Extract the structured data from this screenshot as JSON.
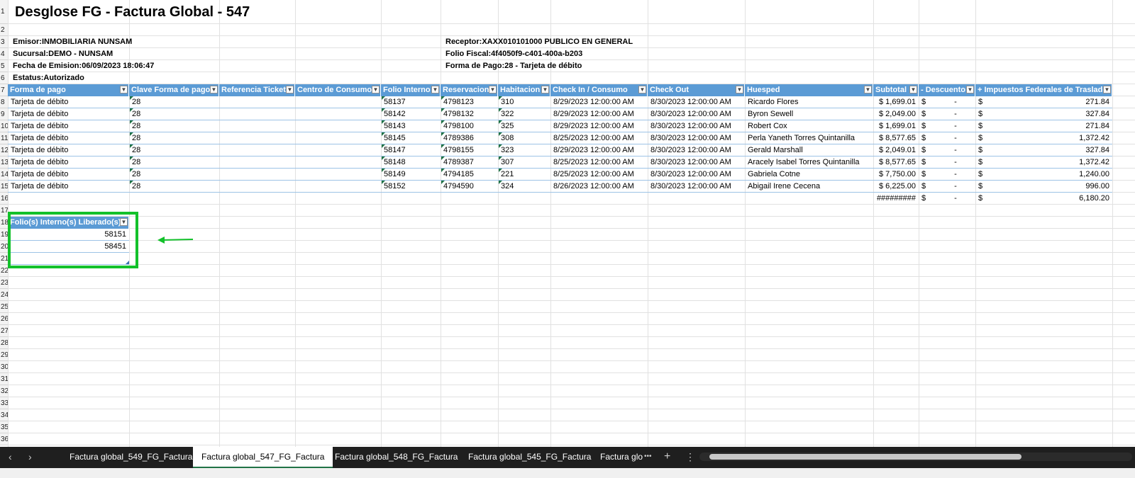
{
  "title": "Desglose FG - Factura Global - 547",
  "info": {
    "emisor": "Emisor:INMOBILIARIA NUNSAM",
    "sucursal": "Sucursal:DEMO - NUNSAM",
    "fecha": "Fecha de Emision:06/09/2023 18:06:47",
    "estatus": "Estatus:Autorizado",
    "receptor": "Receptor:XAXX010101000 PUBLICO EN GENERAL",
    "folio_fiscal": "Folio Fiscal:4f4050f9-c401-400a-b203",
    "forma_pago": "Forma de Pago:28 - Tarjeta de débito"
  },
  "row_numbers": [
    "1",
    "2",
    "3",
    "4",
    "5",
    "6",
    "7",
    "8",
    "9",
    "10",
    "11",
    "12",
    "13",
    "14",
    "15",
    "16",
    "17",
    "18",
    "19",
    "20",
    "21",
    "22",
    "23",
    "24",
    "25",
    "26",
    "27",
    "28",
    "29",
    "30",
    "31",
    "32",
    "33",
    "34",
    "35",
    "36"
  ],
  "table": {
    "headers": [
      "Forma de pago",
      "Clave Forma de pago",
      "Referencia Ticket",
      "Centro de Consumo",
      "Folio Interno",
      "Reservacion",
      "Habitacion",
      "Check In / Consumo",
      "Check Out",
      "Huesped",
      "Subtotal",
      "- Descuento",
      "+ Impuestos Federales de Traslado"
    ],
    "rows": [
      [
        "Tarjeta de débito",
        "28",
        "",
        "",
        "58137",
        "4798123",
        "310",
        "8/29/2023 12:00:00 AM",
        "8/30/2023 12:00:00 AM",
        "Ricardo Flores",
        "$ 1,699.01",
        "$",
        "-",
        "$",
        "271.84"
      ],
      [
        "Tarjeta de débito",
        "28",
        "",
        "",
        "58142",
        "4798132",
        "322",
        "8/29/2023 12:00:00 AM",
        "8/30/2023 12:00:00 AM",
        "Byron Sewell",
        "$ 2,049.00",
        "$",
        "-",
        "$",
        "327.84"
      ],
      [
        "Tarjeta de débito",
        "28",
        "",
        "",
        "58143",
        "4798100",
        "325",
        "8/29/2023 12:00:00 AM",
        "8/30/2023 12:00:00 AM",
        "Robert Cox",
        "$ 1,699.01",
        "$",
        "-",
        "$",
        "271.84"
      ],
      [
        "Tarjeta de débito",
        "28",
        "",
        "",
        "58145",
        "4789386",
        "308",
        "8/25/2023 12:00:00 AM",
        "8/30/2023 12:00:00 AM",
        "Perla Yaneth Torres Quintanilla",
        "$ 8,577.65",
        "$",
        "-",
        "$",
        "1,372.42"
      ],
      [
        "Tarjeta de débito",
        "28",
        "",
        "",
        "58147",
        "4798155",
        "323",
        "8/29/2023 12:00:00 AM",
        "8/30/2023 12:00:00 AM",
        "Gerald Marshall",
        "$ 2,049.01",
        "$",
        "-",
        "$",
        "327.84"
      ],
      [
        "Tarjeta de débito",
        "28",
        "",
        "",
        "58148",
        "4789387",
        "307",
        "8/25/2023 12:00:00 AM",
        "8/30/2023 12:00:00 AM",
        "Aracely Isabel Torres Quintanilla",
        "$ 8,577.65",
        "$",
        "-",
        "$",
        "1,372.42"
      ],
      [
        "Tarjeta de débito",
        "28",
        "",
        "",
        "58149",
        "4794185",
        "221",
        "8/25/2023 12:00:00 AM",
        "8/30/2023 12:00:00 AM",
        "Gabriela Cotne",
        "$ 7,750.00",
        "$",
        "-",
        "$",
        "1,240.00"
      ],
      [
        "Tarjeta de débito",
        "28",
        "",
        "",
        "58152",
        "4794590",
        "324",
        "8/26/2023 12:00:00 AM",
        "8/30/2023 12:00:00 AM",
        "Abigail Irene Cecena",
        "$ 6,225.00",
        "$",
        "-",
        "$",
        "996.00"
      ]
    ],
    "totals": [
      "#########",
      "$",
      "-",
      "$",
      "6,180.20"
    ]
  },
  "liberados": {
    "header": "Folio(s) Interno(s) Liberado(s)",
    "values": [
      "58151",
      "58451"
    ]
  },
  "colors": {
    "table_header": "#5b9bd5",
    "highlight_box": "#13c12b",
    "arrow": "#13c12b"
  },
  "tabs": {
    "items": [
      "Factura global_549_FG_Factura",
      "Factura global_547_FG_Factura",
      "Factura global_548_FG_Factura",
      "Factura global_545_FG_Factura",
      "Factura glo"
    ],
    "active_index": 1,
    "prev": "‹",
    "next": "›",
    "more": "•••",
    "add": "+",
    "options": "⋮"
  }
}
